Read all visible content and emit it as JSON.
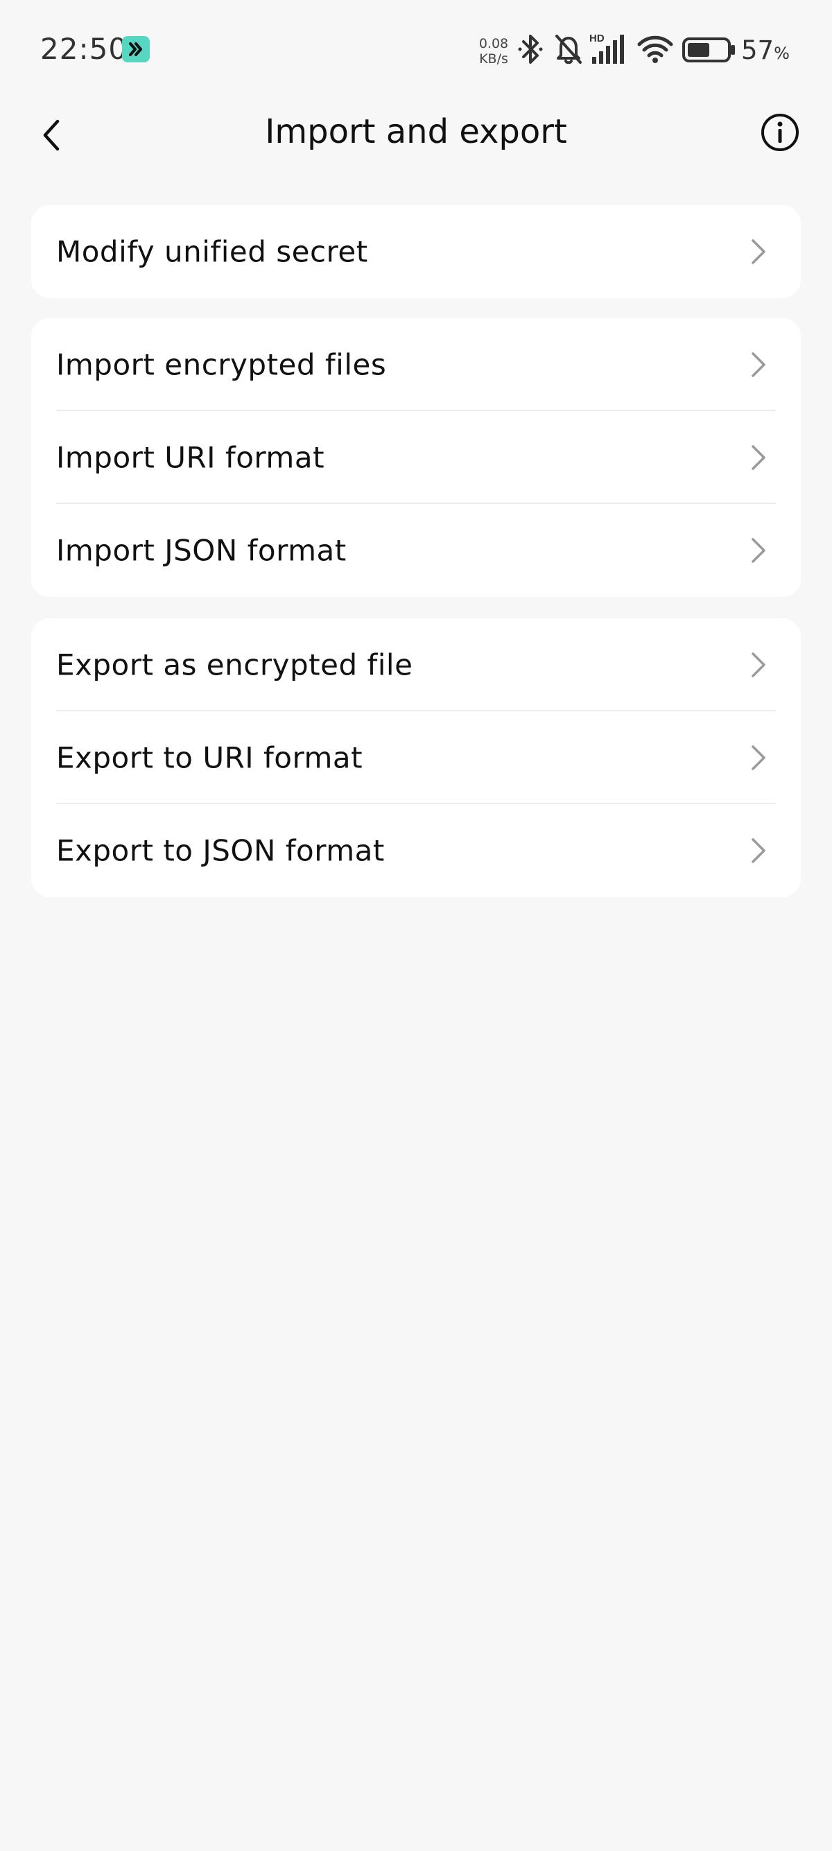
{
  "status_bar": {
    "time": "22:50",
    "net_speed_value": "0.08",
    "net_speed_unit": "KB/s",
    "battery_percent": "57",
    "battery_percent_sign": "%",
    "battery_level": 0.57,
    "icons": [
      "app-badge-icon",
      "bluetooth-icon",
      "bell-off-icon",
      "signal-hd-icon",
      "wifi-icon",
      "battery-icon"
    ]
  },
  "header": {
    "title": "Import and export",
    "back_icon": "chevron-left-icon",
    "info_icon": "info-circle-icon"
  },
  "groups": [
    {
      "items": [
        {
          "label": "Modify unified secret"
        }
      ]
    },
    {
      "items": [
        {
          "label": "Import encrypted files"
        },
        {
          "label": "Import URI format"
        },
        {
          "label": "Import JSON format"
        }
      ]
    },
    {
      "items": [
        {
          "label": "Export as encrypted file"
        },
        {
          "label": "Export to URI format"
        },
        {
          "label": "Export to JSON format"
        }
      ]
    }
  ],
  "colors": {
    "background": "#f7f7f7",
    "card": "#ffffff",
    "divider": "#ececec",
    "chevron": "#9a9a9a",
    "app_badge": "#57d6c1"
  }
}
